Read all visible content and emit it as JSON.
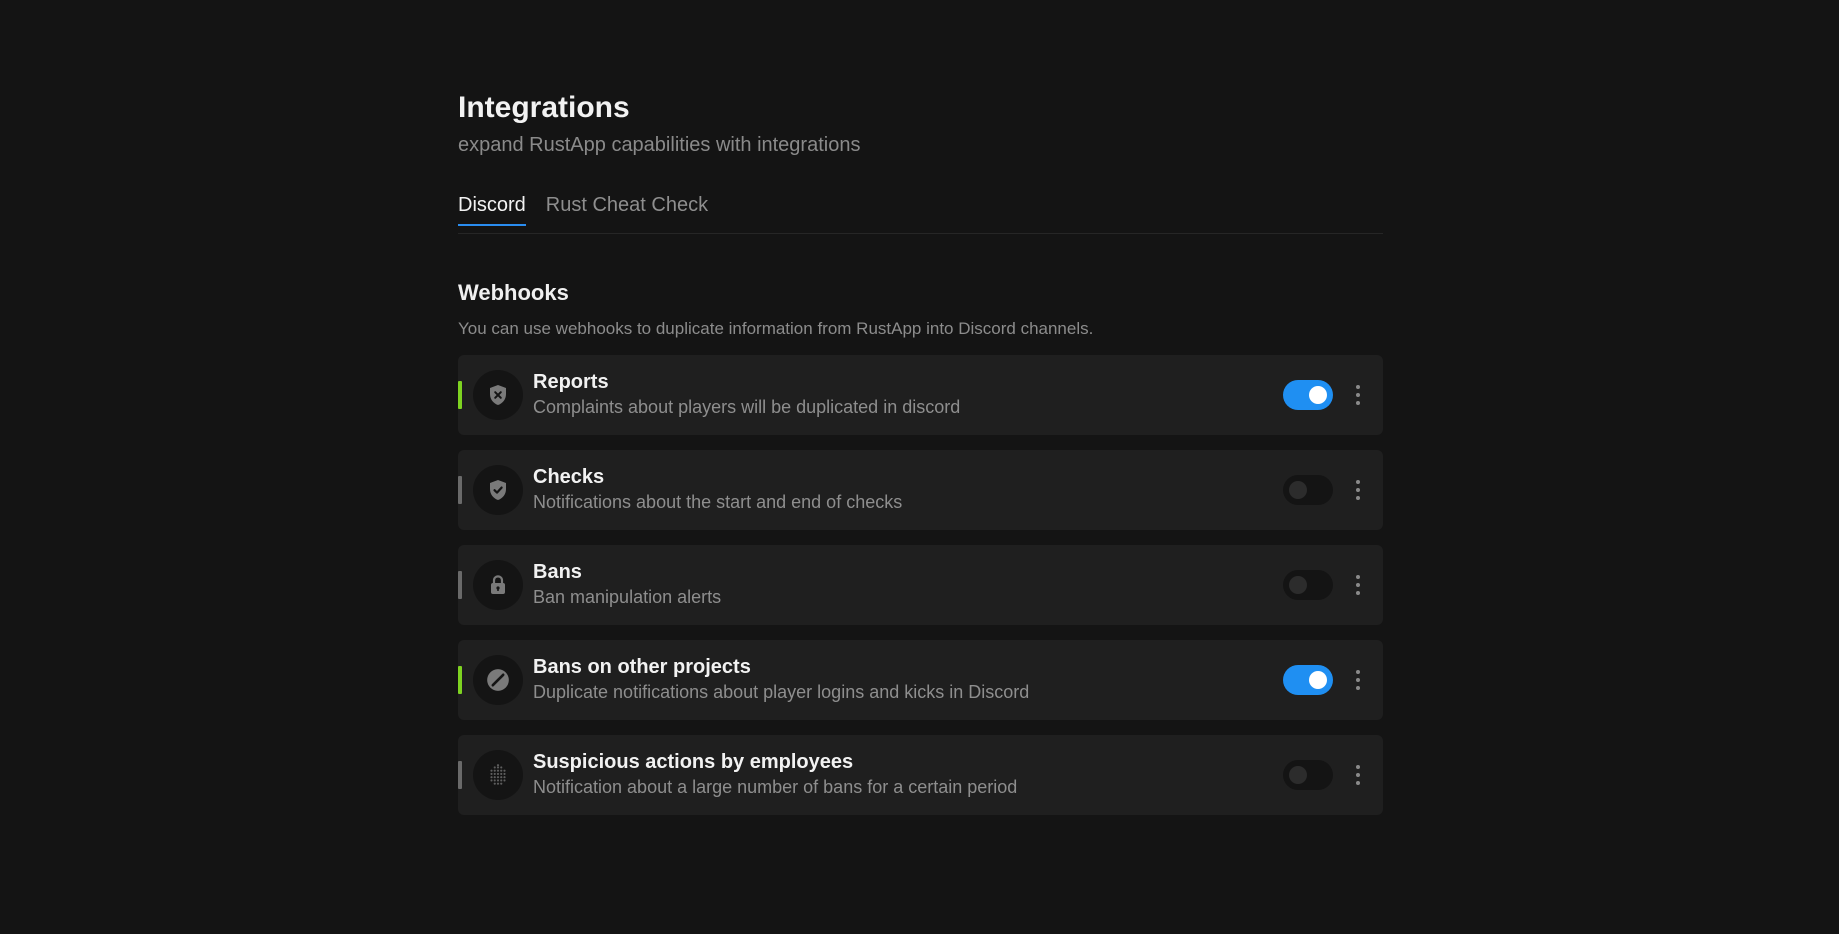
{
  "header": {
    "title": "Integrations",
    "subtitle": "expand RustApp capabilities with integrations"
  },
  "tabs": [
    {
      "label": "Discord",
      "active": true
    },
    {
      "label": "Rust Cheat Check",
      "active": false
    }
  ],
  "section": {
    "title": "Webhooks",
    "description": "You can use webhooks to duplicate information from RustApp into Discord channels."
  },
  "webhooks": [
    {
      "name": "Reports",
      "description": "Complaints about players will be duplicated in discord",
      "enabled": true,
      "icon": "shield-x-icon"
    },
    {
      "name": "Checks",
      "description": "Notifications about the start and end of checks",
      "enabled": false,
      "icon": "shield-check-icon"
    },
    {
      "name": "Bans",
      "description": "Ban manipulation alerts",
      "enabled": false,
      "icon": "lock-icon"
    },
    {
      "name": "Bans on other projects",
      "description": "Duplicate notifications about player logins and kicks in Discord",
      "enabled": true,
      "icon": "prohibited-icon"
    },
    {
      "name": "Suspicious actions by employees",
      "description": "Notification about a large number of bans for a certain period",
      "enabled": false,
      "icon": "fingerprint-icon"
    }
  ],
  "colors": {
    "accent": "#1f8ff2",
    "active_status": "#7ed321",
    "inactive_status": "#6a6a6a",
    "background": "#141414",
    "card": "#1f1f1f"
  }
}
